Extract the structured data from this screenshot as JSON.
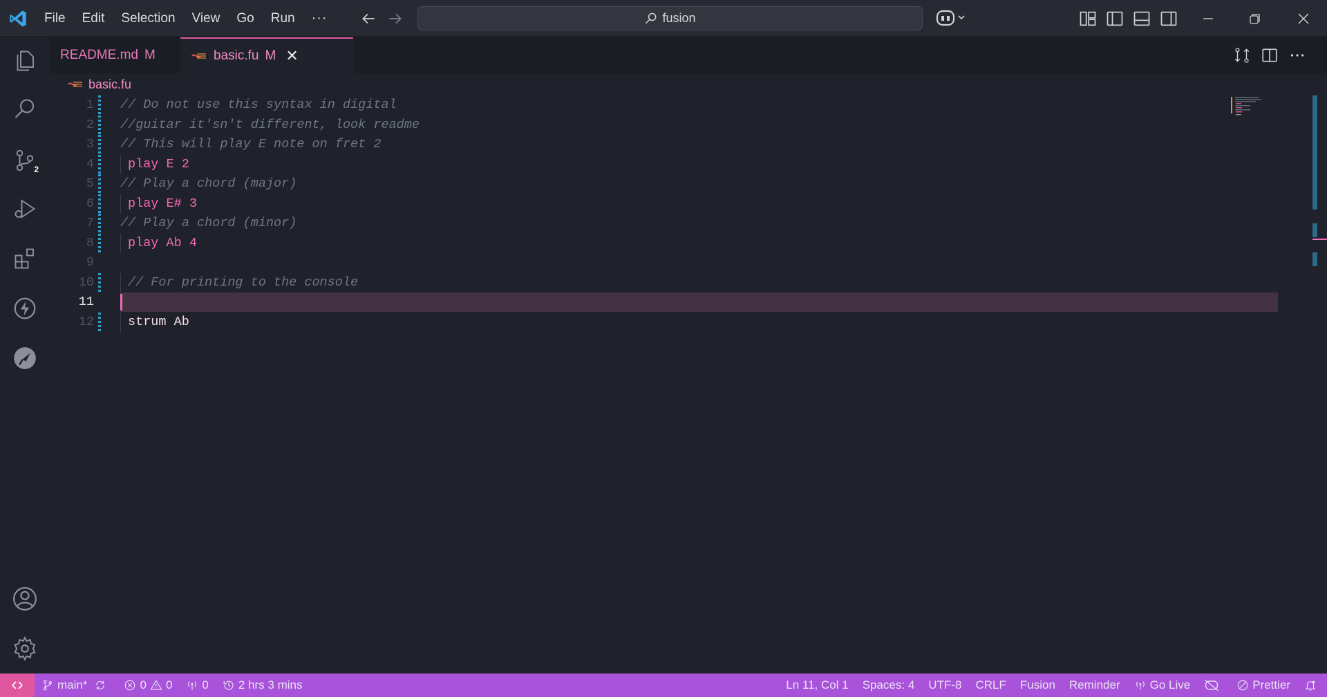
{
  "menu": {
    "items": [
      "File",
      "Edit",
      "Selection",
      "View",
      "Go",
      "Run"
    ],
    "more": "···"
  },
  "search": {
    "text": "fusion"
  },
  "activity": {
    "source_control_badge": "2"
  },
  "tabs": [
    {
      "label": "README.md",
      "status": "M",
      "active": false
    },
    {
      "label": "basic.fu",
      "status": "M",
      "active": true
    }
  ],
  "breadcrumb": {
    "file": "basic.fu"
  },
  "editor": {
    "current_line": 11,
    "lines": [
      {
        "number": "1",
        "text": "// Do not use this syntax in digital",
        "kind": "comment",
        "indent": false
      },
      {
        "number": "2",
        "text": "//guitar it'sn't different, look readme",
        "kind": "comment",
        "indent": false
      },
      {
        "number": "3",
        "text": "// This will play E note on fret 2",
        "kind": "comment",
        "indent": false
      },
      {
        "number": "4",
        "text": "play E 2",
        "kind": "code",
        "indent": true
      },
      {
        "number": "5",
        "text": "// Play a chord (major)",
        "kind": "comment",
        "indent": false
      },
      {
        "number": "6",
        "text": "play E# 3",
        "kind": "code",
        "indent": true
      },
      {
        "number": "7",
        "text": "// Play a chord (minor)",
        "kind": "comment",
        "indent": false
      },
      {
        "number": "8",
        "text": "play Ab 4",
        "kind": "code",
        "indent": true
      },
      {
        "number": "9",
        "text": "",
        "kind": "blank",
        "indent": false
      },
      {
        "number": "10",
        "text": "// For printing to the console",
        "kind": "comment",
        "indent": true
      },
      {
        "number": "11",
        "text": "",
        "kind": "blank",
        "indent": false
      },
      {
        "number": "12",
        "text": "strum Ab",
        "kind": "plain",
        "indent": true
      }
    ]
  },
  "status": {
    "branch": "main*",
    "errors": "0",
    "warnings": "0",
    "ports": "0",
    "time": "2 hrs 3 mins",
    "position": "Ln 11, Col 1",
    "spaces": "Spaces: 4",
    "encoding": "UTF-8",
    "eol": "CRLF",
    "language": "Fusion",
    "reminder": "Reminder",
    "golive": "Go Live",
    "prettier": "Prettier"
  },
  "colors": {
    "accent_pink": "#e0569f",
    "status_bar": "#a853d9",
    "editor_bg": "#1f222b",
    "current_line": "#433342",
    "keyword": "#f56bb5",
    "comment": "#6e7686"
  }
}
